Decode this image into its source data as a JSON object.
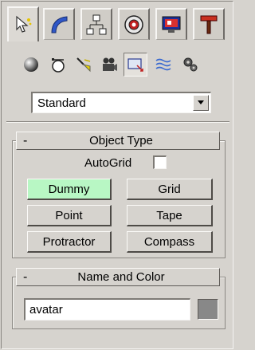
{
  "tabs": [
    {
      "icon": "create-pointer-icon",
      "active": true
    },
    {
      "icon": "modify-bend-icon"
    },
    {
      "icon": "hierarchy-icon"
    },
    {
      "icon": "motion-icon"
    },
    {
      "icon": "display-monitor-icon"
    },
    {
      "icon": "utilities-hammer-icon"
    }
  ],
  "sub_icons": [
    {
      "icon": "geometry-sphere-icon"
    },
    {
      "icon": "shapes-icon"
    },
    {
      "icon": "lights-icon"
    },
    {
      "icon": "cameras-icon"
    },
    {
      "icon": "helpers-icon",
      "pressed": true
    },
    {
      "icon": "space-warps-icon"
    },
    {
      "icon": "systems-icon"
    }
  ],
  "category_dropdown": {
    "value": "Standard"
  },
  "object_type": {
    "minus": "-",
    "title": "Object Type",
    "autogrid_label": "AutoGrid",
    "autogrid_checked": false,
    "buttons": [
      "Dummy",
      "Grid",
      "Point",
      "Tape",
      "Protractor",
      "Compass"
    ],
    "active_button": "Dummy",
    "active_color": "#b8f7c4"
  },
  "name_and_color": {
    "minus": "-",
    "title": "Name and Color",
    "name_value": "avatar",
    "color": "#888888"
  }
}
